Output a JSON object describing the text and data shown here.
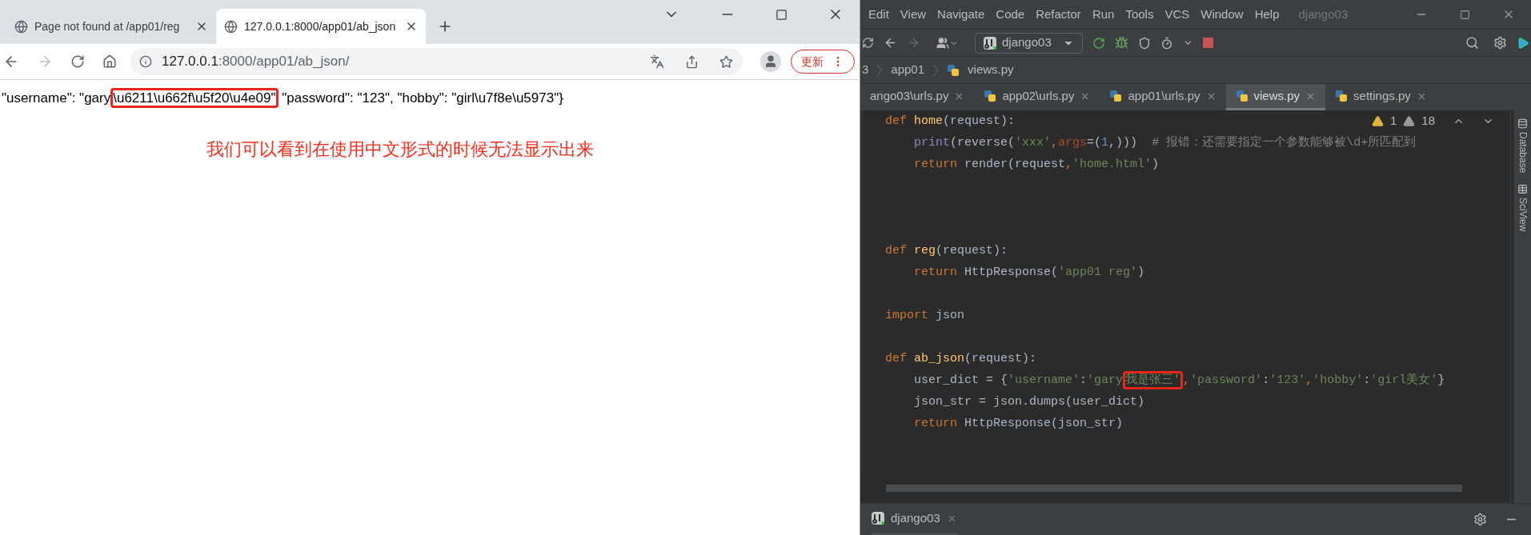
{
  "browser": {
    "tabs": [
      {
        "title": "Page not found at /app01/reg",
        "selected": false
      },
      {
        "title": "127.0.0.1:8000/app01/ab_json",
        "selected": true
      }
    ],
    "address": {
      "host": "127.0.0.1",
      "path": ":8000/app01/ab_json/"
    },
    "update_button": "更新",
    "body": {
      "before": "\"username\": \"gary",
      "boxed": "\\u6211\\u662f\\u5f20\\u4e09\"",
      "after": " \"password\": \"123\", \"hobby\": \"girl\\u7f8e\\u5973\"}"
    },
    "annotation": "我们可以看到在使用中文形式的时候无法显示出来"
  },
  "ide": {
    "menu": [
      "Edit",
      "View",
      "Navigate",
      "Code",
      "Refactor",
      "Run",
      "Tools",
      "VCS",
      "Window",
      "Help"
    ],
    "title": "django03",
    "run_config": "django03",
    "breadcrumb": [
      "3",
      "app01",
      "views.py"
    ],
    "tabs": [
      {
        "title": "ango03\\urls.py",
        "selected": false
      },
      {
        "title": "app02\\urls.py",
        "selected": false
      },
      {
        "title": "app01\\urls.py",
        "selected": false
      },
      {
        "title": "views.py",
        "selected": true
      },
      {
        "title": "settings.py",
        "selected": false
      }
    ],
    "warnings": {
      "weak": "1",
      "strong": "18"
    },
    "code": [
      {
        "kind": "code",
        "indent": false,
        "tokens": [
          {
            "kind": "kw",
            "t": "def "
          },
          {
            "kind": "fn",
            "t": "home"
          },
          {
            "kind": "tx",
            "t": "(request):"
          }
        ]
      },
      {
        "kind": "code",
        "indent": true,
        "tokens": [
          {
            "kind": "builtin",
            "t": "print"
          },
          {
            "kind": "tx",
            "t": "(reverse("
          },
          {
            "kind": "str",
            "t": "'xxx'"
          },
          {
            "kind": "kw",
            "t": ","
          },
          {
            "kind": "param",
            "t": "args"
          },
          {
            "kind": "tx",
            "t": "=("
          },
          {
            "kind": "num",
            "t": "1"
          },
          {
            "kind": "tx",
            "t": ",)))"
          },
          {
            "kind": "cmt",
            "t": "  # 报错：还需要指定一个参数能够被\\d+所匹配到"
          }
        ]
      },
      {
        "kind": "code",
        "indent": true,
        "tokens": [
          {
            "kind": "kw",
            "t": "return "
          },
          {
            "kind": "tx",
            "t": "render(request"
          },
          {
            "kind": "kw",
            "t": ","
          },
          {
            "kind": "str",
            "t": "'home.html'"
          },
          {
            "kind": "tx",
            "t": ")"
          }
        ]
      },
      {
        "kind": "blank"
      },
      {
        "kind": "blank"
      },
      {
        "kind": "blank"
      },
      {
        "kind": "code",
        "indent": false,
        "tokens": [
          {
            "kind": "kw",
            "t": "def "
          },
          {
            "kind": "fn",
            "t": "reg"
          },
          {
            "kind": "tx",
            "t": "(request):"
          }
        ]
      },
      {
        "kind": "code",
        "indent": true,
        "tokens": [
          {
            "kind": "kw",
            "t": "return "
          },
          {
            "kind": "tx",
            "t": "HttpResponse("
          },
          {
            "kind": "str",
            "t": "'app01 reg'"
          },
          {
            "kind": "tx",
            "t": ")"
          }
        ]
      },
      {
        "kind": "blank"
      },
      {
        "kind": "code",
        "indent": false,
        "tokens": [
          {
            "kind": "kw",
            "t": "import "
          },
          {
            "kind": "tx",
            "t": "json"
          }
        ]
      },
      {
        "kind": "blank"
      },
      {
        "kind": "code",
        "indent": false,
        "tokens": [
          {
            "kind": "kw",
            "t": "def "
          },
          {
            "kind": "fn",
            "t": "ab_json"
          },
          {
            "kind": "tx",
            "t": "(request):"
          }
        ]
      },
      {
        "kind": "code",
        "indent": true,
        "tokens": [
          {
            "kind": "tx",
            "t": "user_dict = {"
          },
          {
            "kind": "str",
            "t": "'username'"
          },
          {
            "kind": "tx",
            "t": ":"
          },
          {
            "kind": "str",
            "t": "'gary"
          },
          {
            "kind": "str",
            "t": "我是张三'",
            "boxed": true
          },
          {
            "kind": "kw",
            "t": ","
          },
          {
            "kind": "str",
            "t": "'password'"
          },
          {
            "kind": "tx",
            "t": ":"
          },
          {
            "kind": "str",
            "t": "'123'"
          },
          {
            "kind": "kw",
            "t": ","
          },
          {
            "kind": "str",
            "t": "'hobby'"
          },
          {
            "kind": "tx",
            "t": ":"
          },
          {
            "kind": "str",
            "t": "'girl美女'"
          },
          {
            "kind": "tx",
            "t": "}"
          }
        ]
      },
      {
        "kind": "code",
        "indent": true,
        "tokens": [
          {
            "kind": "tx",
            "t": "json_str = json.dumps(user_dict)"
          }
        ]
      },
      {
        "kind": "code",
        "indent": true,
        "tokens": [
          {
            "kind": "kw",
            "t": "return "
          },
          {
            "kind": "tx",
            "t": "HttpResponse(json_str)"
          }
        ]
      }
    ],
    "side_tools": [
      "Database",
      "SciView"
    ],
    "bottom_tab": "django03"
  }
}
